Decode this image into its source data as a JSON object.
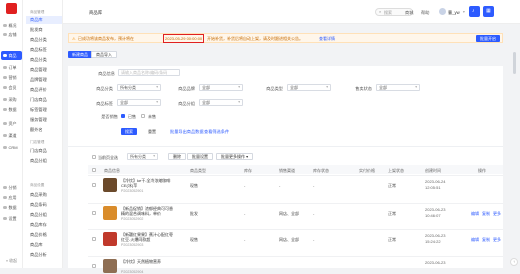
{
  "rail": {
    "items": [
      {
        "label": "概况",
        "icon": "dashboard-icon"
      },
      {
        "label": "店铺",
        "icon": "store-icon"
      },
      {
        "label": "商品",
        "icon": "goods-icon"
      },
      {
        "label": "订单",
        "icon": "order-icon"
      },
      {
        "label": "营销",
        "icon": "marketing-icon"
      },
      {
        "label": "会员",
        "icon": "member-icon"
      },
      {
        "label": "采购",
        "icon": "purchase-icon"
      },
      {
        "label": "数据",
        "icon": "data-icon"
      },
      {
        "label": "资产",
        "icon": "asset-icon"
      },
      {
        "label": "渠道",
        "icon": "channel-icon"
      },
      {
        "label": "CRM",
        "icon": "crm-icon"
      },
      {
        "label": "分销",
        "icon": "distribution-icon"
      },
      {
        "label": "应用",
        "icon": "app-icon"
      },
      {
        "label": "数据",
        "icon": "stats-icon"
      },
      {
        "label": "设置",
        "icon": "settings-icon"
      }
    ],
    "collapse_label": "收起"
  },
  "submenu": {
    "group1": "商品管理",
    "items1": [
      "商品库",
      "批发商",
      "商品分类",
      "商品标签",
      "商品分类",
      "商品管理",
      "品牌管理",
      "商品评价",
      "门店商品",
      "标签管理",
      "服务管理",
      "额外名"
    ],
    "group2": "门店管理",
    "items2": [
      "门店商品",
      "商品分组"
    ],
    "group3": "商品设置",
    "items3": [
      "商品采购",
      "商品条码",
      "商品分组",
      "商品库存",
      "商品价格",
      "商品库",
      "商品分析"
    ]
  },
  "topbar": {
    "breadcrumb": "商品库",
    "search_placeholder": "搜索",
    "links": [
      "商城",
      "帮助"
    ],
    "user": "曹_yw"
  },
  "alert": {
    "text_before": "已成功将该商品发布，预计将在",
    "date": "2023-05-29 00:00:00",
    "text_after": "开始补货，补货后将自动上架，请及时跟进相关公告。",
    "link": "查看详情",
    "button": "批量开启"
  },
  "filters": {
    "tab_primary": "新建商品",
    "tab_secondary": "商品导入",
    "name_label": "商品信息",
    "name_placeholder": "请输入商品名称/编码/条码",
    "row1": [
      {
        "label": "商品分类",
        "value": "所有分类"
      },
      {
        "label": "商品品牌",
        "value": "全部"
      },
      {
        "label": "商品类型",
        "value": "全部"
      },
      {
        "label": "售卖状态",
        "value": "全部"
      }
    ],
    "row2": [
      {
        "label": "商品标签",
        "value": "全部"
      },
      {
        "label": "商品分组",
        "value": "全部"
      }
    ],
    "status_label": "是否销售",
    "opt_yes": "已售",
    "opt_no": "未售",
    "search_btn": "搜索",
    "reset_btn": "重置",
    "export_link": "批量导出商品数据",
    "save_link": "查看筛选条件"
  },
  "toolbar": {
    "select_all": "当前页全选",
    "category": "所有分类",
    "delete": "删除",
    "batch_tag": "批量设置",
    "batch_more": "批量更多操作"
  },
  "table": {
    "headers": [
      "商品信息",
      "商品类型",
      "库存",
      "销售渠道",
      "库存状态",
      "实付价格",
      "上架状态",
      "创建时间",
      "操作"
    ],
    "rows": [
      {
        "name": "【冷饮】ke干-全冷浓缩咖啡CE(冰)苹",
        "code": "P2023052901",
        "type": "现售",
        "stock": "-",
        "channel": "-",
        "price": "-",
        "status": "正常",
        "date": "2023-06-24",
        "time": "12:05:51",
        "color": "#6b4a2b",
        "actions": []
      },
      {
        "name": "【新品促销】浓郁经典可可香精的混合调味料，单价",
        "code": "P2023052902",
        "type": "批发",
        "stock": "-",
        "channel": "网店、全部",
        "price": "-",
        "status": "正常",
        "date": "2023-06-23",
        "time": "10:46:07",
        "color": "#d98c2b",
        "actions": [
          "编辑",
          "复制",
          "更多"
        ]
      },
      {
        "name": "【新疆红果果】蕉汁心配红枣红豆-火爆同款超",
        "code": "P2023052903",
        "type": "现售",
        "stock": "-",
        "channel": "网店、全部",
        "price": "-",
        "status": "正常",
        "date": "2023-06-23",
        "time": "15:24:22",
        "color": "#c0392b",
        "actions": [
          "编辑",
          "复制",
          "更多"
        ]
      },
      {
        "name": "【冷饮】天然植物营养",
        "code": "P2023052904",
        "type": "",
        "stock": "",
        "channel": "",
        "price": "",
        "status": "",
        "date": "2023-06-23",
        "time": "",
        "color": "#8e6e53",
        "actions": []
      }
    ]
  },
  "colors": {
    "accent": "#2d5bff",
    "brand": "#e02020",
    "alert_highlight": "#e02020"
  }
}
